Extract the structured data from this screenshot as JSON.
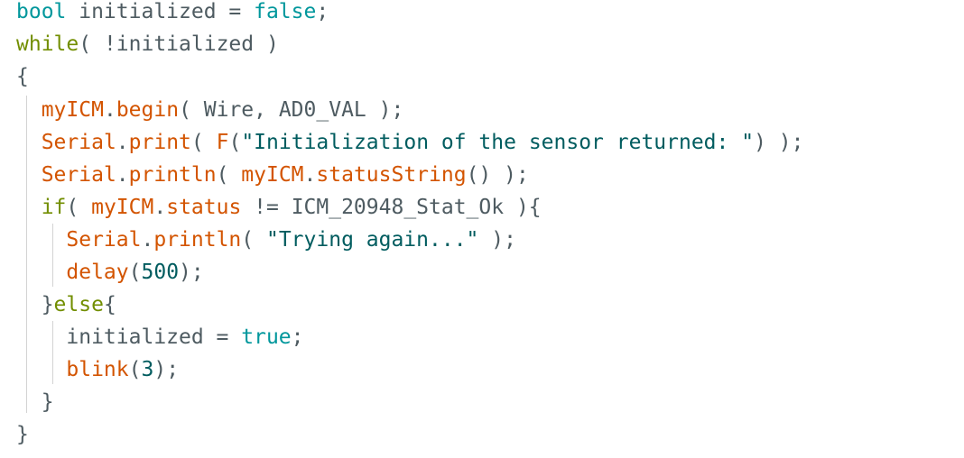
{
  "editor": {
    "colors": {
      "background": "#ffffff",
      "type": "#00979c",
      "keyword": "#728e00",
      "function": "#d35400",
      "string": "#005c5f",
      "constant": "#00979c",
      "number": "#005c5f",
      "plain": "#4e5b61",
      "indent_guide": "#d3d3d3"
    },
    "lines": [
      {
        "tokens": [
          {
            "text": "bool",
            "kind": "type"
          },
          {
            "text": " initialized = ",
            "kind": "ident"
          },
          {
            "text": "false",
            "kind": "const"
          },
          {
            "text": ";",
            "kind": "punct"
          }
        ]
      },
      {
        "tokens": [
          {
            "text": "while",
            "kind": "keyword"
          },
          {
            "text": "( !initialized )",
            "kind": "punct"
          }
        ]
      },
      {
        "tokens": [
          {
            "text": "{",
            "kind": "punct"
          }
        ]
      },
      {
        "tokens": [
          {
            "text": "  ",
            "kind": "ident"
          },
          {
            "text": "myICM",
            "kind": "func"
          },
          {
            "text": ".",
            "kind": "punct"
          },
          {
            "text": "begin",
            "kind": "func"
          },
          {
            "text": "( Wire, AD0_VAL );",
            "kind": "punct"
          }
        ]
      },
      {
        "tokens": [
          {
            "text": "  ",
            "kind": "ident"
          },
          {
            "text": "Serial",
            "kind": "func"
          },
          {
            "text": ".",
            "kind": "punct"
          },
          {
            "text": "print",
            "kind": "func"
          },
          {
            "text": "( ",
            "kind": "punct"
          },
          {
            "text": "F",
            "kind": "func"
          },
          {
            "text": "(",
            "kind": "punct"
          },
          {
            "text": "\"Initialization of the sensor returned: \"",
            "kind": "string"
          },
          {
            "text": ") );",
            "kind": "punct"
          }
        ]
      },
      {
        "tokens": [
          {
            "text": "  ",
            "kind": "ident"
          },
          {
            "text": "Serial",
            "kind": "func"
          },
          {
            "text": ".",
            "kind": "punct"
          },
          {
            "text": "println",
            "kind": "func"
          },
          {
            "text": "( ",
            "kind": "punct"
          },
          {
            "text": "myICM",
            "kind": "func"
          },
          {
            "text": ".",
            "kind": "punct"
          },
          {
            "text": "statusString",
            "kind": "func"
          },
          {
            "text": "() );",
            "kind": "punct"
          }
        ]
      },
      {
        "tokens": [
          {
            "text": "  ",
            "kind": "ident"
          },
          {
            "text": "if",
            "kind": "keyword"
          },
          {
            "text": "( ",
            "kind": "punct"
          },
          {
            "text": "myICM",
            "kind": "func"
          },
          {
            "text": ".",
            "kind": "punct"
          },
          {
            "text": "status",
            "kind": "func"
          },
          {
            "text": " != ICM_20948_Stat_Ok ){",
            "kind": "punct"
          }
        ]
      },
      {
        "tokens": [
          {
            "text": "    ",
            "kind": "ident"
          },
          {
            "text": "Serial",
            "kind": "func"
          },
          {
            "text": ".",
            "kind": "punct"
          },
          {
            "text": "println",
            "kind": "func"
          },
          {
            "text": "( ",
            "kind": "punct"
          },
          {
            "text": "\"Trying again...\"",
            "kind": "string"
          },
          {
            "text": " );",
            "kind": "punct"
          }
        ]
      },
      {
        "tokens": [
          {
            "text": "    ",
            "kind": "ident"
          },
          {
            "text": "delay",
            "kind": "func"
          },
          {
            "text": "(",
            "kind": "punct"
          },
          {
            "text": "500",
            "kind": "number"
          },
          {
            "text": ");",
            "kind": "punct"
          }
        ]
      },
      {
        "tokens": [
          {
            "text": "  }",
            "kind": "punct"
          },
          {
            "text": "else",
            "kind": "keyword"
          },
          {
            "text": "{",
            "kind": "punct"
          }
        ]
      },
      {
        "tokens": [
          {
            "text": "    initialized = ",
            "kind": "ident"
          },
          {
            "text": "true",
            "kind": "const"
          },
          {
            "text": ";",
            "kind": "punct"
          }
        ]
      },
      {
        "tokens": [
          {
            "text": "    ",
            "kind": "ident"
          },
          {
            "text": "blink",
            "kind": "func"
          },
          {
            "text": "(",
            "kind": "punct"
          },
          {
            "text": "3",
            "kind": "number"
          },
          {
            "text": ");",
            "kind": "punct"
          }
        ]
      },
      {
        "tokens": [
          {
            "text": "  }",
            "kind": "punct"
          }
        ]
      },
      {
        "tokens": [
          {
            "text": "}",
            "kind": "punct"
          }
        ]
      }
    ]
  }
}
